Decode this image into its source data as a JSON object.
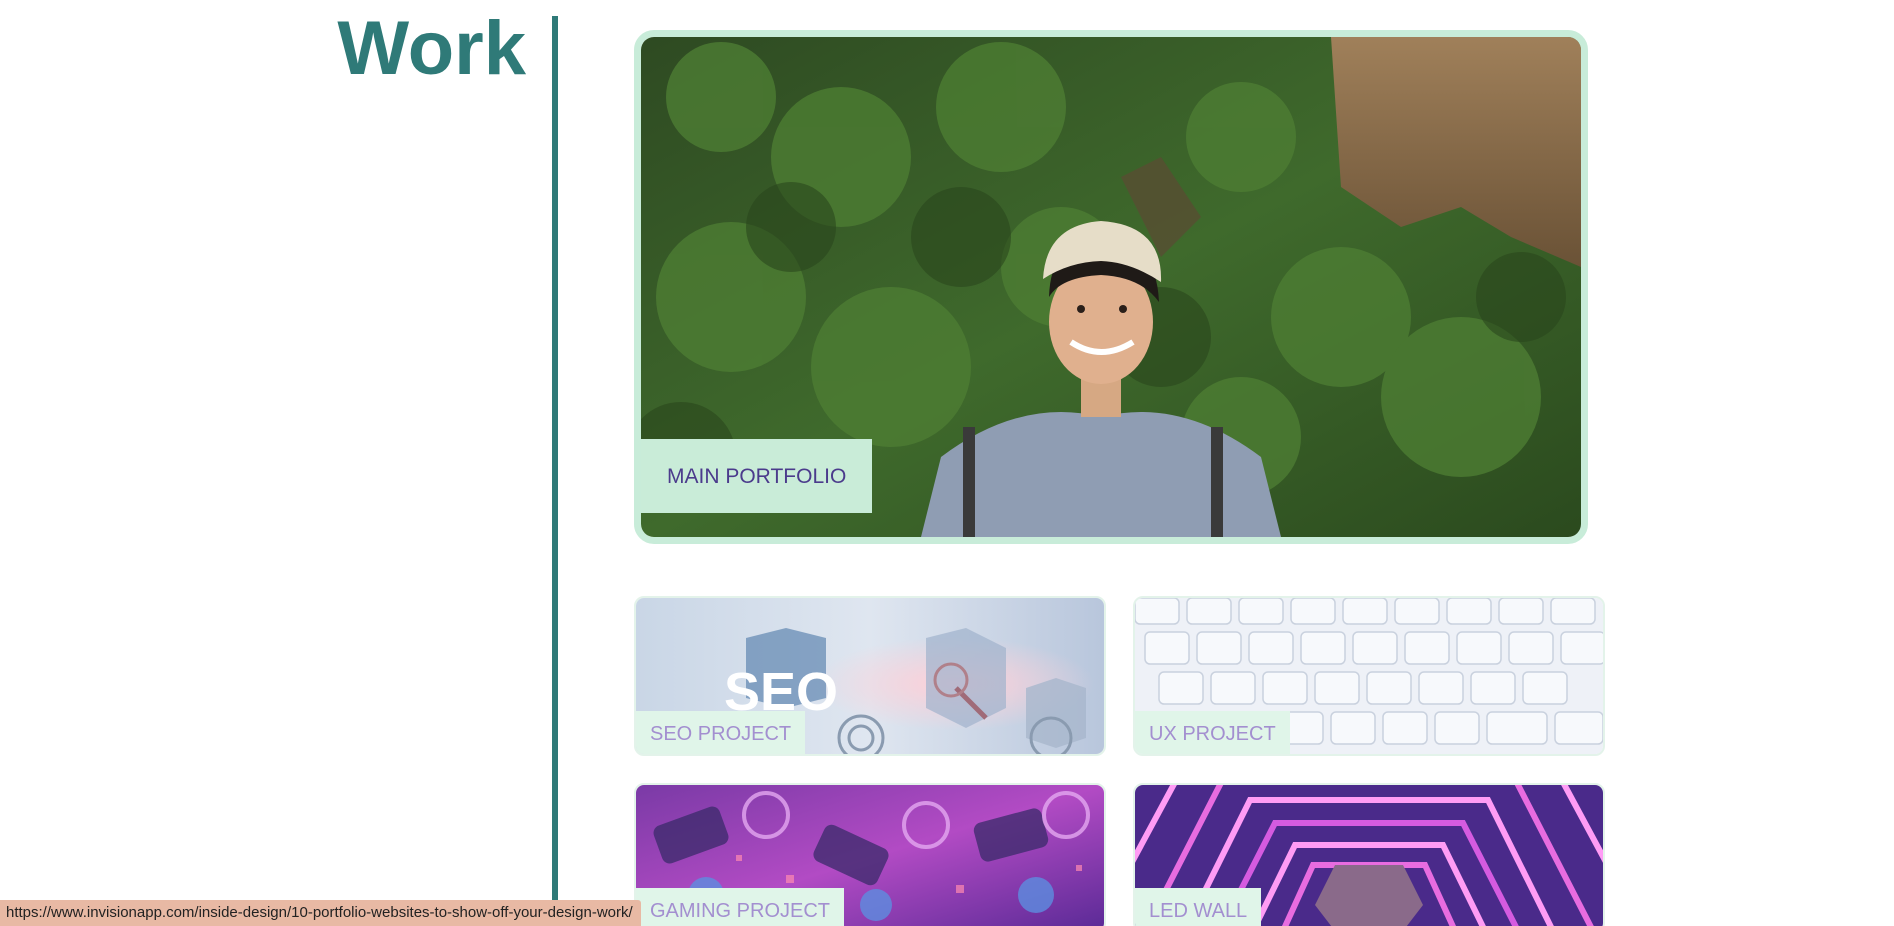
{
  "page": {
    "heading": "Work"
  },
  "cards": {
    "main": {
      "label": "MAIN PORTFOLIO"
    },
    "seo": {
      "label": "SEO PROJECT",
      "image_text": "SEO"
    },
    "ux": {
      "label": "UX PROJECT"
    },
    "gaming": {
      "label": "GAMING PROJECT"
    },
    "led": {
      "label": "LED WALL"
    }
  },
  "status_bar": {
    "url": "https://www.invisionapp.com/inside-design/10-portfolio-websites-to-show-off-your-design-work/"
  },
  "colors": {
    "accent": "#2f7a78",
    "card_border": "#c8ecd9",
    "caption_bg": "#d3f0df",
    "caption_text": "#4a3a8a",
    "status_bar_bg": "#e8b9a4"
  }
}
